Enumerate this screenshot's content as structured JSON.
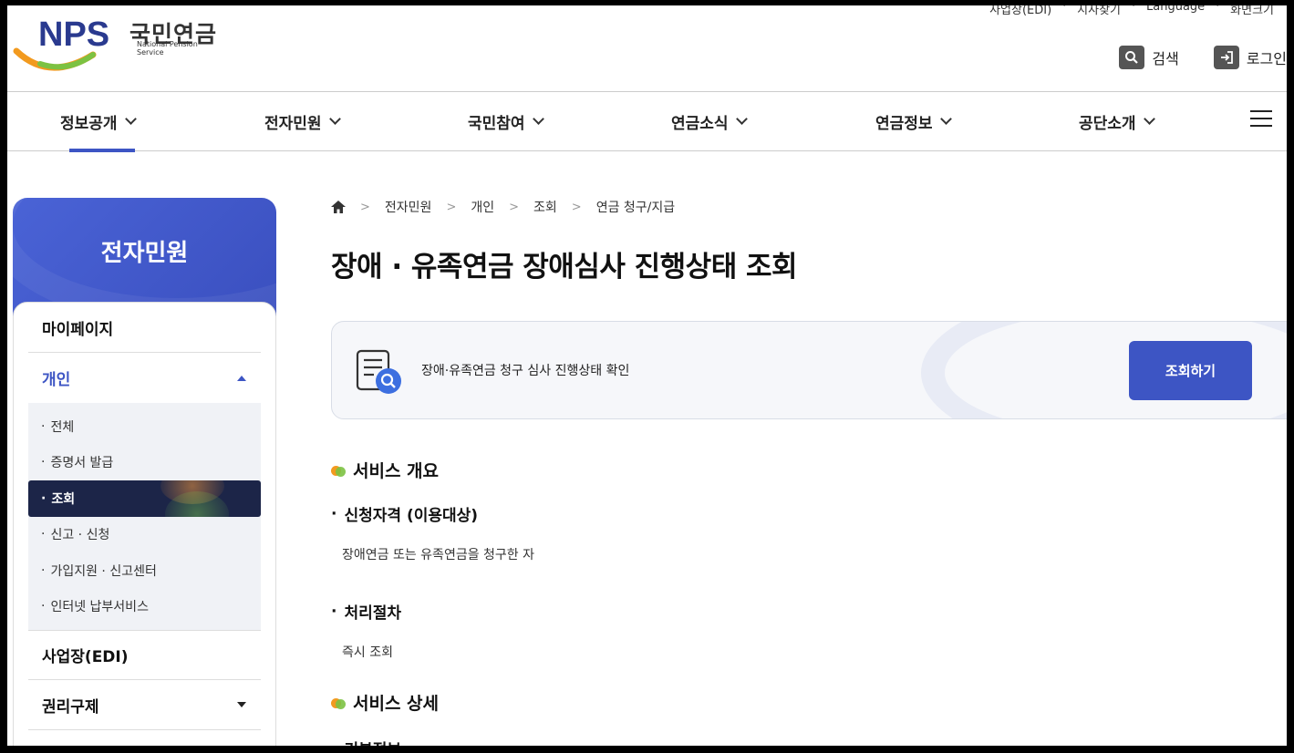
{
  "utility": [
    "사업장(EDI)",
    "지사찾기",
    "Language",
    "화면크기"
  ],
  "logo": {
    "brand": "NPS",
    "kr": "국민연금",
    "en": "National Pension Service"
  },
  "header_buttons": {
    "search": "검색",
    "login": "로그인"
  },
  "gnb": [
    "정보공개",
    "전자민원",
    "국민참여",
    "연금소식",
    "연금정보",
    "공단소개"
  ],
  "sidebar": {
    "title": "전자민원",
    "items": {
      "mypage": "마이페이지",
      "personal": "개인",
      "personal_sub": [
        "전체",
        "증명서 발급",
        "조회",
        "신고 · 신청",
        "가입지원 · 신고센터",
        "인터넷 납부서비스"
      ],
      "edi": "사업장(EDI)",
      "relief": "권리구제"
    }
  },
  "breadcrumb": [
    "전자민원",
    "개인",
    "조회",
    "연금 청구/지급"
  ],
  "page_title": "장애 · 유족연금 장애심사 진행상태 조회",
  "service_box": {
    "text": "장애·유족연금 청구 심사 진행상태 확인",
    "button": "조회하기"
  },
  "overview": {
    "title": "서비스 개요",
    "eligibility_title": "신청자격 (이용대상)",
    "eligibility_text": "장애연금 또는 유족연금을 청구한 자",
    "process_title": "처리절차",
    "process_text": "즉시 조회"
  },
  "detail": {
    "title": "서비스 상세",
    "basic_info": "기본정보"
  },
  "colors": {
    "accent": "#3d55c4",
    "active_sub": "#1c2548"
  }
}
